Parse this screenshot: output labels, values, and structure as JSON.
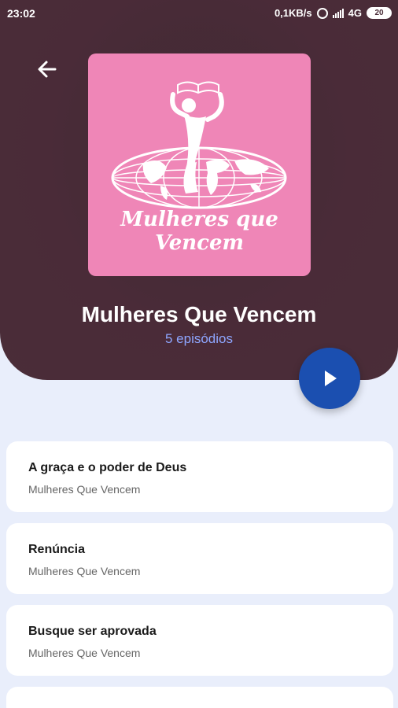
{
  "status_bar": {
    "time": "23:02",
    "speed": "0,1KB/s",
    "network": "4G",
    "battery": "20"
  },
  "podcast": {
    "cover_text": "Mulheres que Vencem",
    "title": "Mulheres Que Vencem",
    "episodes_count": "5 episódios"
  },
  "colors": {
    "header_bg": "#4a2d38",
    "cover_bg": "#ef86b7",
    "accent": "#1b4fb0",
    "subtitle": "#8ea6ff"
  },
  "episodes": [
    {
      "title": "A graça e o poder de Deus",
      "author": "Mulheres Que Vencem"
    },
    {
      "title": "Renúncia",
      "author": "Mulheres Que Vencem"
    },
    {
      "title": "Busque ser aprovada",
      "author": "Mulheres Que Vencem"
    }
  ]
}
